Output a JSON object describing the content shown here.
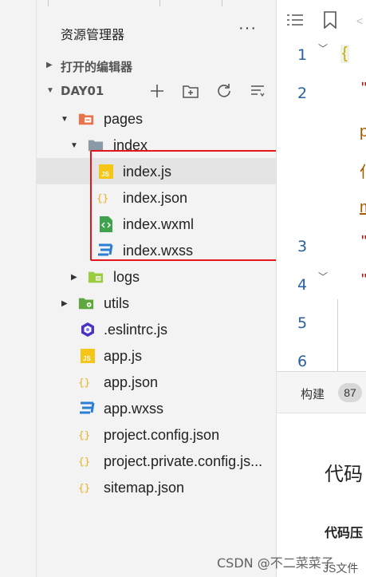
{
  "explorer": {
    "title": "资源管理器",
    "more": "···",
    "open_editors_label": "打开的编辑器",
    "project_label": "DAY01"
  },
  "tree": {
    "pages": "pages",
    "index": "index",
    "index_js": "index.js",
    "index_json": "index.json",
    "index_wxml": "index.wxml",
    "index_wxss": "index.wxss",
    "logs": "logs",
    "utils": "utils",
    "eslintrc": ".eslintrc.js",
    "app_js": "app.js",
    "app_json": "app.json",
    "app_wxss": "app.wxss",
    "project_config": "project.config.json",
    "project_private_config": "project.private.config.js...",
    "sitemap": "sitemap.json"
  },
  "editor": {
    "line_numbers": [
      "1",
      "2",
      "3",
      "4",
      "5",
      "6"
    ],
    "code_fragments": [
      "{",
      "\"",
      "p",
      "仆",
      "m",
      "\"",
      "\""
    ]
  },
  "bottom_panel": {
    "build_tab": "构建",
    "build_count": "87",
    "heading": "代码",
    "subheading": "代码压",
    "filetype_text": "JS文件"
  },
  "watermark": "CSDN @不二菜菜子",
  "colors": {
    "highlight_border": "#e5161b",
    "line_number": "#2860a0",
    "folder_orange": "#e8734c",
    "folder_green": "#7cb342",
    "js_yellow": "#f5c518",
    "json_yellow": "#e6b422",
    "wxss_blue": "#2a7fd4",
    "eslint_purple": "#4b32c3"
  }
}
